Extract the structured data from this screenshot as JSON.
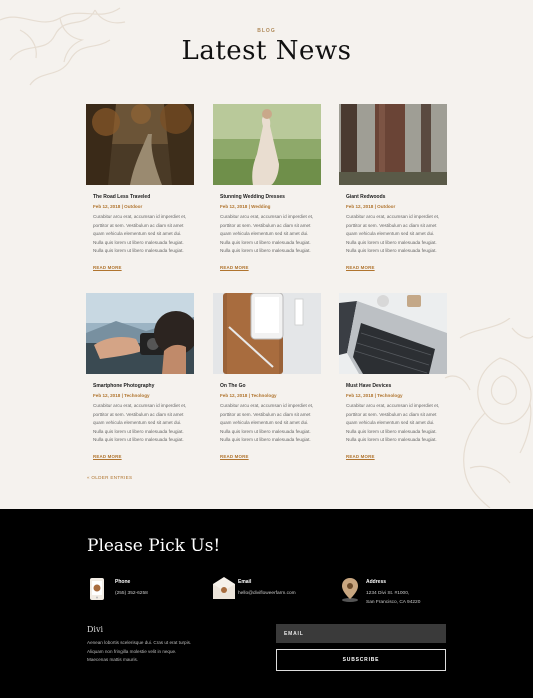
{
  "blog": {
    "eyebrow": "BLOG",
    "title": "Latest News",
    "posts": [
      {
        "title": "The Road Less Traveled",
        "meta": "Feb 12, 2018 | Outdoor",
        "excerpt": "Curabitur arcu erat, accumsan id imperdiet et, porttitor at sem. Vestibulum ac diam sit amet quam vehicula elementum sed sit amet dui. Nulla quis lorem ut libero malesuada feugiat. Nulla quis lorem ut libero malesuada feugiat.",
        "read_more": "READ MORE",
        "image": "forest-road-photo"
      },
      {
        "title": "Stunning Wedding Dresses",
        "meta": "Feb 12, 2018 | Wedding",
        "excerpt": "Curabitur arcu erat, accumsan id imperdiet et, porttitor at sem. Vestibulum ac diam sit amet quam vehicula elementum sed sit amet dui. Nulla quis lorem ut libero malesuada feugiat. Nulla quis lorem ut libero malesuada feugiat.",
        "read_more": "READ MORE",
        "image": "wedding-dress-photo"
      },
      {
        "title": "Giant Redwoods",
        "meta": "Feb 12, 2018 | Outdoor",
        "excerpt": "Curabitur arcu erat, accumsan id imperdiet et, porttitor at sem. Vestibulum ac diam sit amet quam vehicula elementum sed sit amet dui. Nulla quis lorem ut libero malesuada feugiat. Nulla quis lorem ut libero malesuada feugiat.",
        "read_more": "READ MORE",
        "image": "redwood-trees-photo"
      },
      {
        "title": "Smartphone Photography",
        "meta": "Feb 12, 2018 | Technology",
        "excerpt": "Curabitur arcu erat, accumsan id imperdiet et, porttitor at sem. Vestibulum ac diam sit amet quam vehicula elementum sed sit amet dui. Nulla quis lorem ut libero malesuada feugiat. Nulla quis lorem ut libero malesuada feugiat.",
        "read_more": "READ MORE",
        "image": "smartphone-photo"
      },
      {
        "title": "On The Go",
        "meta": "Feb 12, 2018 | Technology",
        "excerpt": "Curabitur arcu erat, accumsan id imperdiet et, porttitor at sem. Vestibulum ac diam sit amet quam vehicula elementum sed sit amet dui. Nulla quis lorem ut libero malesuada feugiat. Nulla quis lorem ut libero malesuada feugiat.",
        "read_more": "READ MORE",
        "image": "phone-on-tablet-photo"
      },
      {
        "title": "Must Have Devices",
        "meta": "Feb 12, 2018 | Technology",
        "excerpt": "Curabitur arcu erat, accumsan id imperdiet et, porttitor at sem. Vestibulum ac diam sit amet quam vehicula elementum sed sit amet dui. Nulla quis lorem ut libero malesuada feugiat. Nulla quis lorem ut libero malesuada feugiat.",
        "read_more": "READ MORE",
        "image": "laptop-keyboard-photo"
      }
    ],
    "older_entries": "« OLDER ENTRIES"
  },
  "footer": {
    "title": "Please Pick Us!",
    "contacts": [
      {
        "icon": "phone-icon",
        "label": "Phone",
        "lines": [
          "(255) 352-6258"
        ]
      },
      {
        "icon": "envelope-icon",
        "label": "Email",
        "lines": [
          "hello@divifloweerfarm.com"
        ]
      },
      {
        "icon": "map-pin-icon",
        "label": "Address",
        "lines": [
          "1234 Divi St. #1000,",
          "San Francisco, CA 94220"
        ]
      }
    ],
    "about_title": "Divi",
    "about_text": "Aenean lobortis scelerisque dui. Cras ut erat turpis. Aliquam non fringilla molestie velit in neque. Maecenas mattis mauris.",
    "email_placeholder": "EMAIL",
    "subscribe_label": "SUBSCRIBE"
  },
  "colors": {
    "background": "#f5f2ee",
    "accent": "#b0742e",
    "footer_bg": "#000000",
    "input_bg": "#3a3a3a"
  }
}
